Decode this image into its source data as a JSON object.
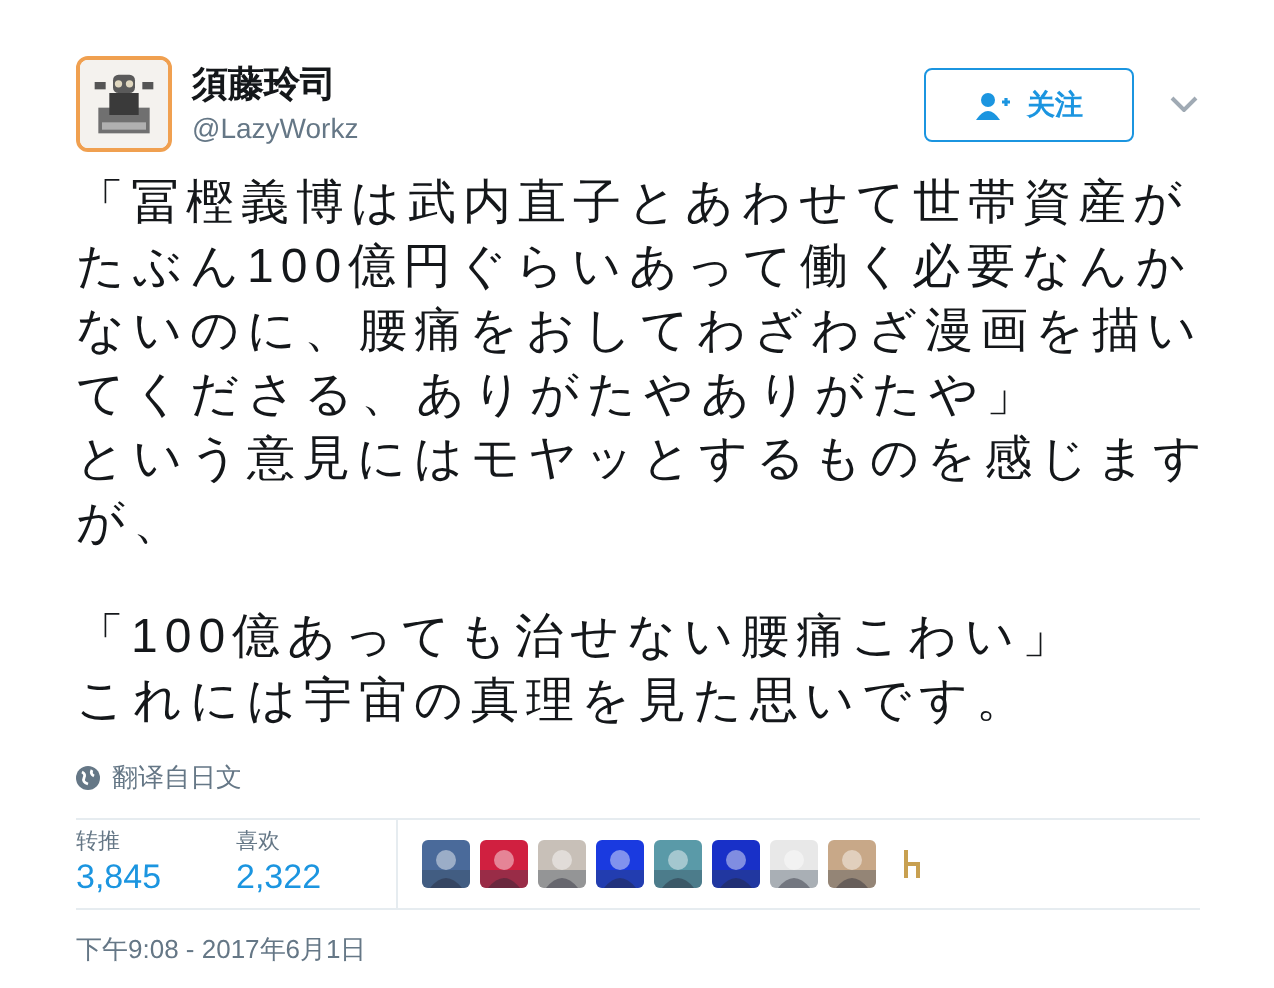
{
  "user": {
    "name": "須藤玲司",
    "handle": "@LazyWorkz"
  },
  "follow_button": {
    "label": "关注"
  },
  "tweet": {
    "paragraphs": [
      {
        "lines": [
          "「冨樫義博は武内直子とあわせて世帯資産が",
          "たぶん100億円ぐらいあって働く必要なんか",
          "ないのに、腰痛をおしてわざわざ漫画を描い",
          "てくださる、ありがたやありがたや」",
          "という意見にはモヤッとするものを感じます",
          "が、"
        ]
      },
      {
        "lines": [
          "「100億あっても治せない腰痛こわい」",
          "これには宇宙の真理を見た思いです。"
        ]
      }
    ]
  },
  "translate_link": "翻译自日文",
  "stats": [
    {
      "label": "转推",
      "value": "3,845"
    },
    {
      "label": "喜欢",
      "value": "2,322"
    }
  ],
  "likers": [
    {
      "color": "#4a6a9a"
    },
    {
      "color": "#d02040"
    },
    {
      "color": "#c8c0b8"
    },
    {
      "color": "#1a3ae0"
    },
    {
      "color": "#5a9aa8"
    },
    {
      "color": "#1830c8"
    },
    {
      "color": "#e8e8e8"
    },
    {
      "color": "#c8a888"
    },
    {
      "kind": "icon"
    }
  ],
  "timestamp": "下午9:08 - 2017年6月1日"
}
